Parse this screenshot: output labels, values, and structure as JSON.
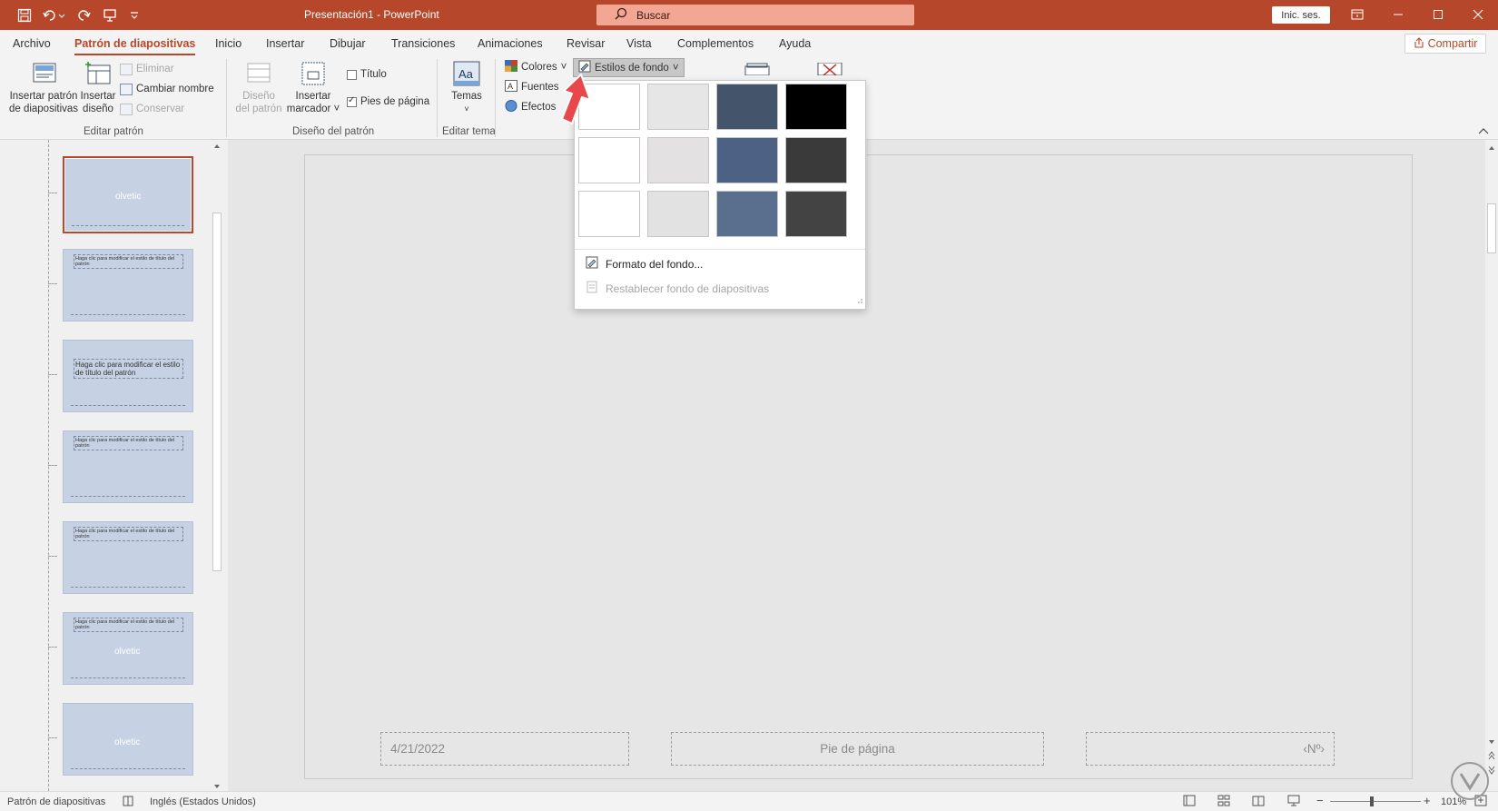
{
  "titlebar": {
    "doc_title": "Presentación1  -  PowerPoint",
    "search_placeholder": "Buscar",
    "signin_label": "Inic. ses."
  },
  "tabs": [
    {
      "label": "Archivo"
    },
    {
      "label": "Patrón de diapositivas",
      "active": true
    },
    {
      "label": "Inicio"
    },
    {
      "label": "Insertar"
    },
    {
      "label": "Dibujar"
    },
    {
      "label": "Transiciones"
    },
    {
      "label": "Animaciones"
    },
    {
      "label": "Revisar"
    },
    {
      "label": "Vista"
    },
    {
      "label": "Complementos"
    },
    {
      "label": "Ayuda"
    }
  ],
  "share_label": "Compartir",
  "ribbon": {
    "editar_patron": {
      "group_label": "Editar patrón",
      "insert_master_line1": "Insertar patrón",
      "insert_master_line2": "de diapositivas",
      "insert_layout_line1": "Insertar",
      "insert_layout_line2": "diseño",
      "delete": "Eliminar",
      "rename": "Cambiar nombre",
      "preserve": "Conservar"
    },
    "diseno_patron": {
      "group_label": "Diseño del patrón",
      "master_layout_line1": "Diseño",
      "master_layout_line2": "del patrón",
      "insert_placeholder_line1": "Insertar",
      "insert_placeholder_line2": "marcador",
      "title_check": "Título",
      "footer_check": "Pies de página"
    },
    "editar_tema": {
      "group_label": "Editar tema",
      "themes": "Temas"
    },
    "fondo": {
      "colors": "Colores",
      "fonts": "Fuentes",
      "effects": "Efectos",
      "bg_styles": "Estilos de fondo"
    }
  },
  "thumbs": [
    {
      "watermark": "olvetic"
    },
    {
      "title": "Haga clic para modificar el estilo de título del patrón"
    },
    {
      "title": "Haga clic para modificar el estilo de título del patrón"
    },
    {
      "title": "Haga clic para modificar el estilo de título del patrón"
    },
    {
      "title": "Haga clic para modificar el estilo de título del patrón"
    },
    {
      "title": "Haga clic para modificar el estilo de título del patrón",
      "watermark": "olvetic"
    },
    {
      "watermark": "olvetic"
    }
  ],
  "slide": {
    "date": "4/21/2022",
    "footer": "Pie de página",
    "number": "‹Nº›"
  },
  "bg_menu": {
    "swatch_colors": [
      "#ffffff",
      "#e7e6e6",
      "#44546a",
      "#000000",
      "#ffffff",
      "#e3e1e1",
      "#4d6185",
      "#3a3a3a",
      "#ffffff",
      "#e2e2e2",
      "#5a6e8e",
      "#434343"
    ],
    "format_bg": "Formato del fondo...",
    "reset_bg": "Restablecer fondo de diapositivas"
  },
  "statusbar": {
    "view_name": "Patrón de diapositivas",
    "language": "Inglés (Estados Unidos)",
    "zoom": "101%"
  },
  "colors": {
    "accent": "#b7472a",
    "search_bg": "#f1a794"
  }
}
